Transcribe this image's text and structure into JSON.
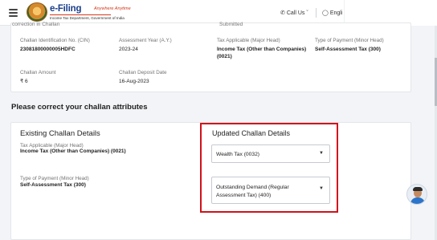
{
  "header": {
    "logo_title": "e-Filing",
    "logo_tagline": "Anywhere Anytime",
    "logo_subtitle": "Income Tax Department, Government of India",
    "call_us": "Call Us",
    "language": "Engli"
  },
  "top_card": {
    "cut_left": "correction in Challan",
    "cut_right": "Submitted",
    "fields": {
      "cin_label": "Challan Identification No. (CIN)",
      "cin_value": "23081800000005HDFC",
      "ay_label": "Assessment Year (A.Y.)",
      "ay_value": "2023-24",
      "major_label": "Tax Applicable (Major Head)",
      "major_value": "Income Tax (Other than Companies) (0021)",
      "minor_label": "Type of Payment (Minor Head)",
      "minor_value": "Self-Assessment Tax (300)",
      "amount_label": "Challan Amount",
      "amount_value": "₹ 6",
      "date_label": "Challan Deposit Date",
      "date_value": "16-Aug-2023"
    }
  },
  "section_title": "Please correct your challan attributes",
  "existing": {
    "title": "Existing Challan Details",
    "major_label": "Tax Applicable (Major Head)",
    "major_value": "Income Tax (Other than Companies) (0021)",
    "minor_label": "Type of Payment (Minor Head)",
    "minor_value": "Self-Assessment Tax (300)"
  },
  "updated": {
    "title": "Updated Challan Details",
    "major_select": "Wealth Tax (0032)",
    "minor_select_line1": "Outstanding Demand (Regular",
    "minor_select_line2": "Assessment Tax) (400)"
  },
  "colors": {
    "highlight": "#d0121b",
    "brand_blue": "#1a3e8c",
    "brand_red": "#d4371c"
  },
  "icons": [
    "menu-icon",
    "phone-icon",
    "globe-icon",
    "caret-down-icon",
    "chatbot-avatar-icon"
  ]
}
